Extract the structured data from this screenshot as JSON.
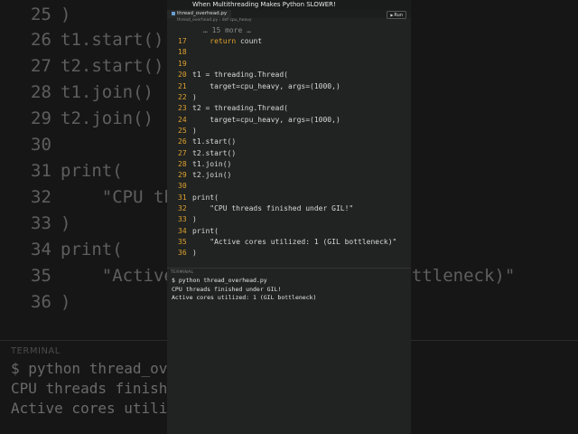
{
  "background_editor": {
    "lines": [
      {
        "num": "25",
        "code": ")"
      },
      {
        "num": "26",
        "code": "t1.start()"
      },
      {
        "num": "27",
        "code": "t2.start()"
      },
      {
        "num": "28",
        "code": "t1.join()"
      },
      {
        "num": "29",
        "code": "t2.join()"
      },
      {
        "num": "30",
        "code": ""
      },
      {
        "num": "31",
        "code": "print("
      },
      {
        "num": "32",
        "code": "    \"CPU th                    L!\""
      },
      {
        "num": "33",
        "code": ")"
      },
      {
        "num": "34",
        "code": "print("
      },
      {
        "num": "35",
        "code": "    \"Active                     bottleneck)\""
      },
      {
        "num": "36",
        "code": ")"
      }
    ],
    "terminal_label": "TERMINAL",
    "terminal_lines": [
      "$ python thread_over",
      "CPU threads finished",
      "Active cores utilize"
    ]
  },
  "window": {
    "title": "When Multithreading Makes Python SLOWER!",
    "tab": "thread_overhead.py",
    "run_label": "Run",
    "breadcrumb": "thread_overhead.py › def cpu_heavy",
    "folded_text": "… 15 more …"
  },
  "code_lines": [
    {
      "num": "17",
      "text": "    return count"
    },
    {
      "num": "18",
      "text": ""
    },
    {
      "num": "19",
      "text": ""
    },
    {
      "num": "20",
      "text": "t1 = threading.Thread("
    },
    {
      "num": "21",
      "text": "    target=cpu_heavy, args=(1000,)"
    },
    {
      "num": "22",
      "text": ")"
    },
    {
      "num": "23",
      "text": "t2 = threading.Thread("
    },
    {
      "num": "24",
      "text": "    target=cpu_heavy, args=(1000,)"
    },
    {
      "num": "25",
      "text": ")"
    },
    {
      "num": "26",
      "text": "t1.start()"
    },
    {
      "num": "27",
      "text": "t2.start()"
    },
    {
      "num": "28",
      "text": "t1.join()"
    },
    {
      "num": "29",
      "text": "t2.join()"
    },
    {
      "num": "30",
      "text": ""
    },
    {
      "num": "31",
      "text": "print("
    },
    {
      "num": "32",
      "text": "    \"CPU threads finished under GIL!\""
    },
    {
      "num": "33",
      "text": ")"
    },
    {
      "num": "34",
      "text": "print("
    },
    {
      "num": "35",
      "text": "    \"Active cores utilized: 1 (GIL bottleneck)\""
    },
    {
      "num": "36",
      "text": ")"
    }
  ],
  "terminal": {
    "label": "TERMINAL",
    "lines": [
      "$ python thread_overhead.py",
      "CPU threads finished under GIL!",
      "Active cores utilized: 1 (GIL bottleneck)"
    ]
  },
  "colors": {
    "accent": "#e0a030",
    "window_bg": "#202321",
    "page_bg": "#161616"
  }
}
